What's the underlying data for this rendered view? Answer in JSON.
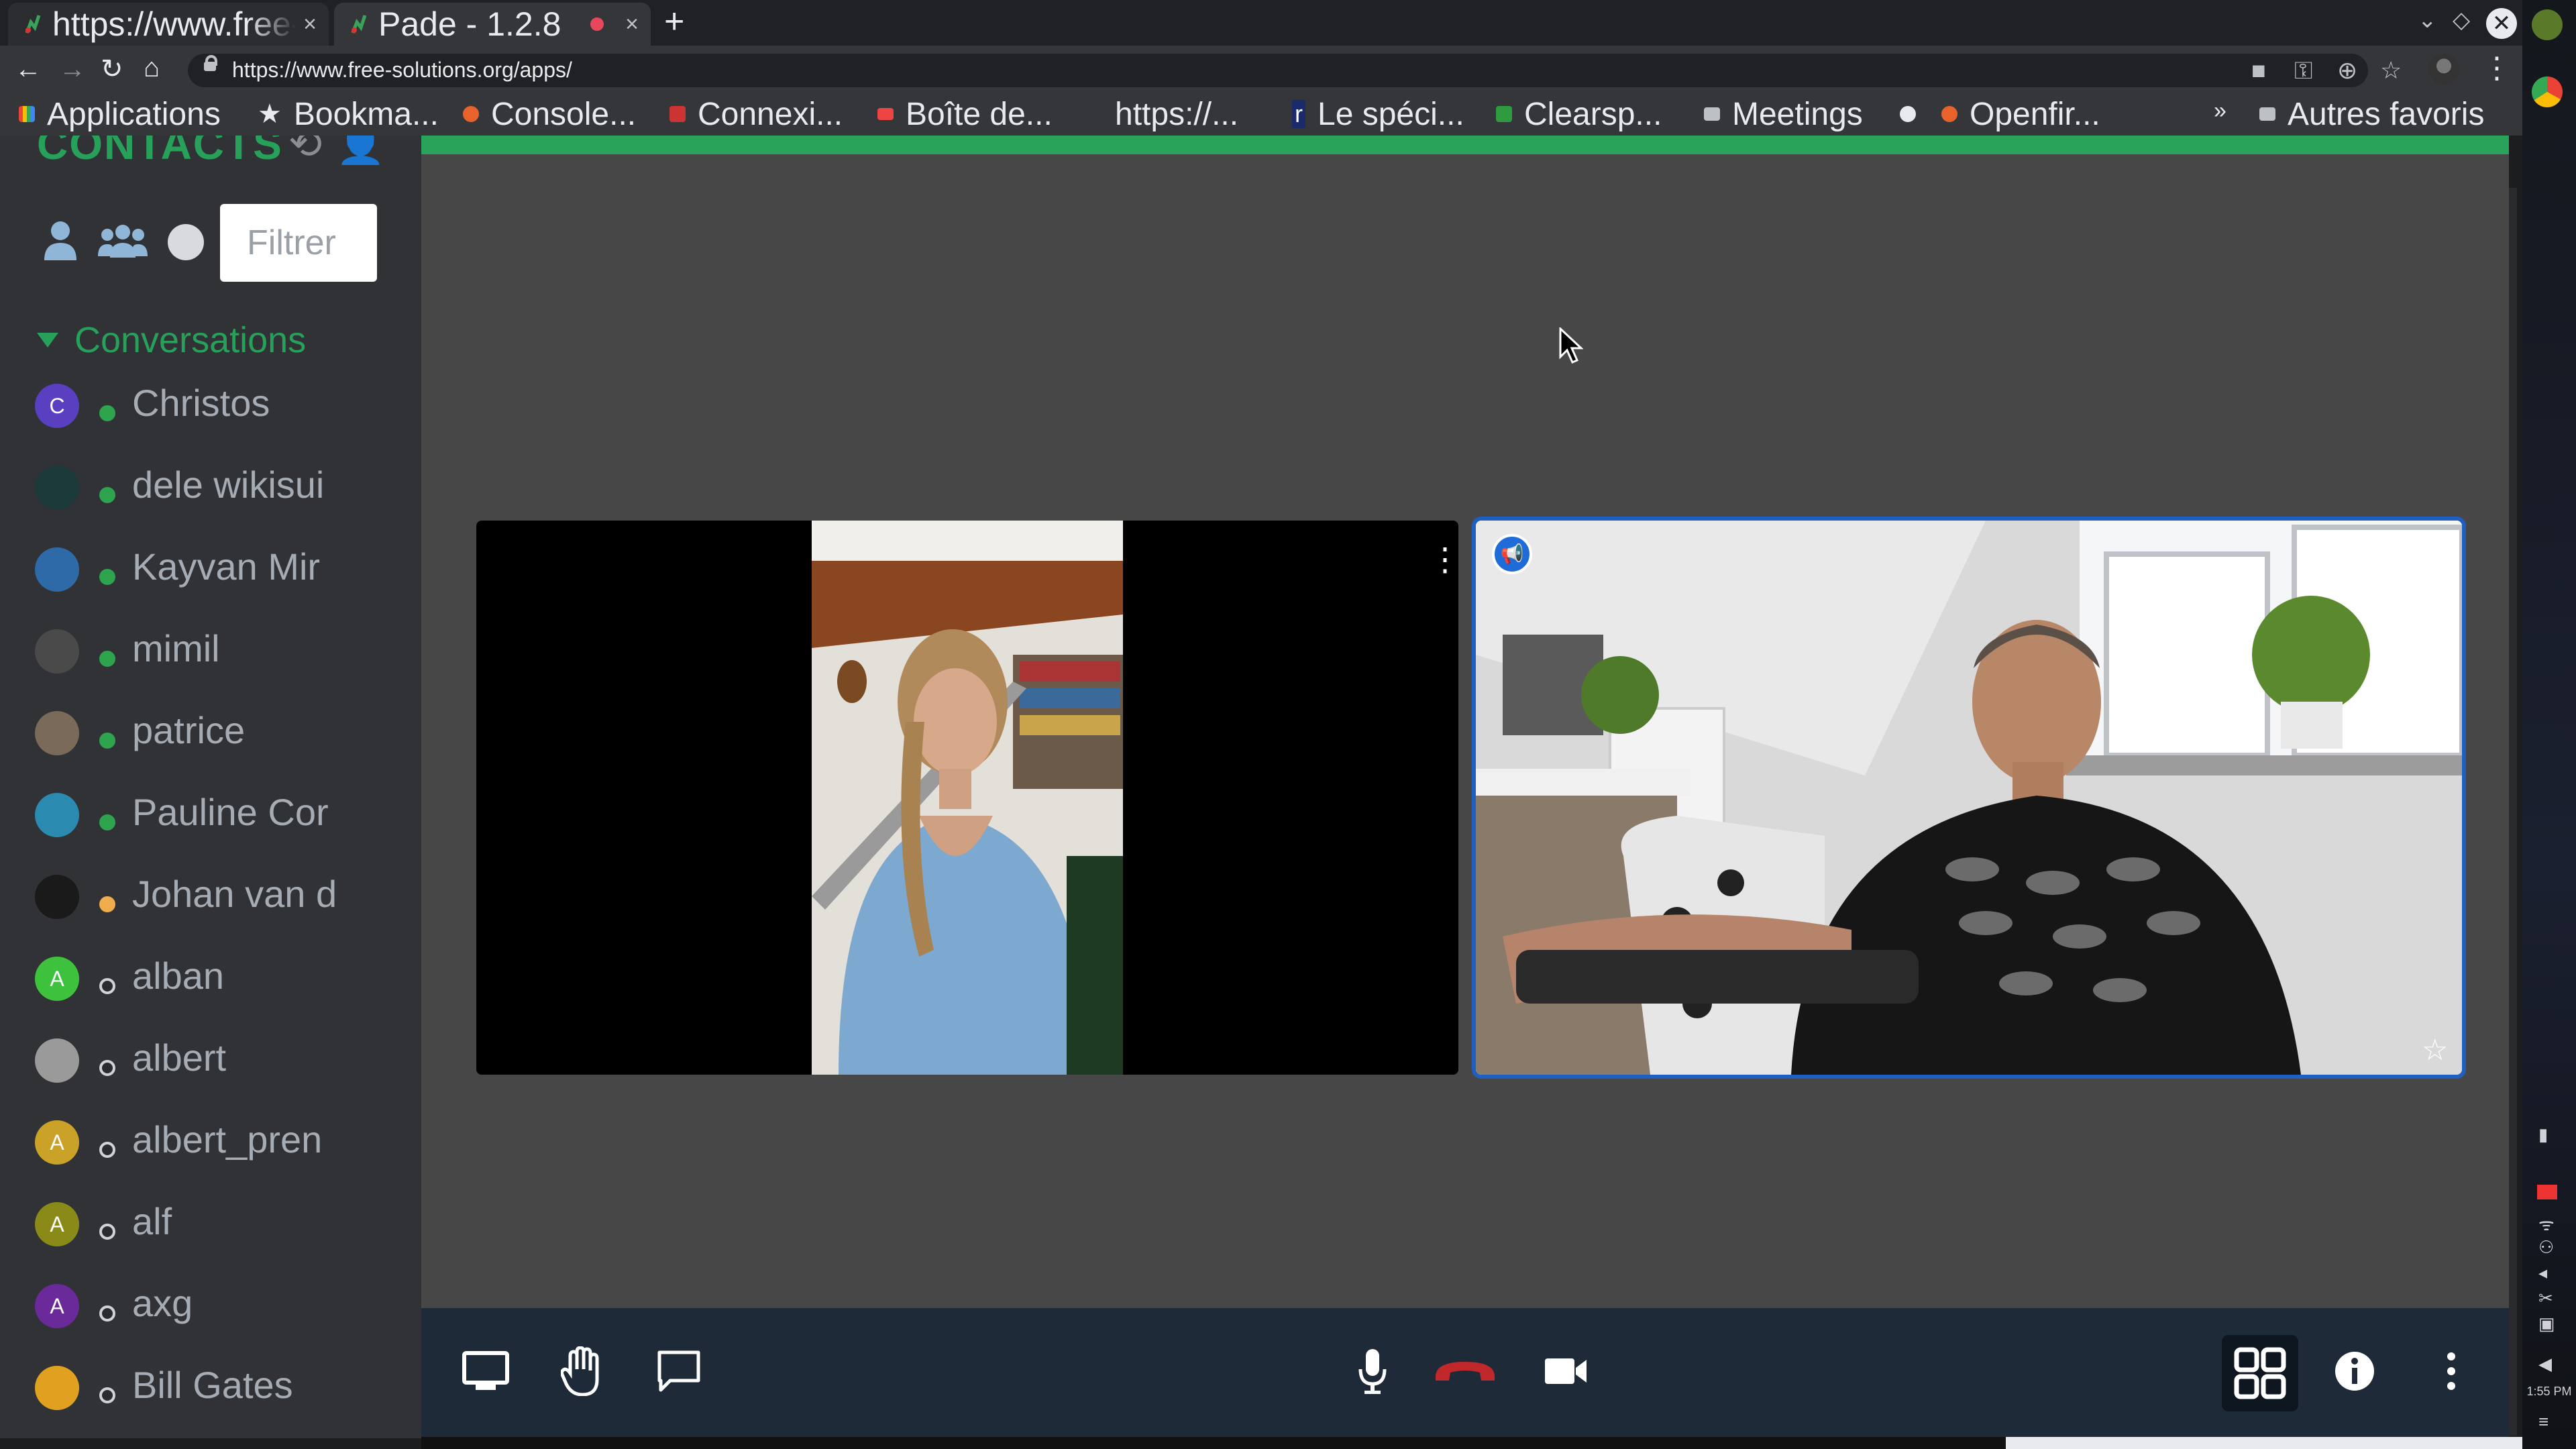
{
  "browser": {
    "tabs": [
      {
        "title": "https://www.free-solutions.org/apps/",
        "close": "×"
      },
      {
        "title": "Pade - 1.2.8",
        "close": "×"
      }
    ],
    "new_tab": "+",
    "url": "https://www.free-solutions.org/apps/",
    "bookmarks": [
      {
        "label": "Applications",
        "icon": "apps-grid-icon"
      },
      {
        "label": "Bookma...",
        "icon": "star-icon"
      },
      {
        "label": "Console...",
        "icon": "openfire-icon"
      },
      {
        "label": "Connexi...",
        "icon": "connexion-icon"
      },
      {
        "label": "Boîte de...",
        "icon": "gmail-icon"
      },
      {
        "label": "https://...",
        "icon": "page-icon"
      },
      {
        "label": "Le spéci...",
        "icon": "r-icon"
      },
      {
        "label": "Clearsp...",
        "icon": "clearspace-icon"
      },
      {
        "label": "Meetings",
        "icon": "folder-icon"
      },
      {
        "label": "",
        "icon": "globe-icon"
      },
      {
        "label": "Openfir...",
        "icon": "openfire-icon"
      },
      {
        "label": "Autres favoris",
        "icon": "folder-icon"
      }
    ],
    "bookmarks_more": "»"
  },
  "sidebar": {
    "title": "CONTACTS",
    "filter_placeholder": "Filtrer",
    "conversations_label": "Conversations",
    "contacts": [
      {
        "name": "Christos",
        "initial": "C",
        "status": "online",
        "avatar_color": "#5a3fc0"
      },
      {
        "name": "dele wikisui",
        "initial": "",
        "status": "online",
        "avatar_color": "#1c3a3a"
      },
      {
        "name": "Kayvan Mir",
        "initial": "",
        "status": "online",
        "avatar_color": "#2f6aa8"
      },
      {
        "name": "mimil",
        "initial": "",
        "status": "online",
        "avatar_color": "#4a4a4a"
      },
      {
        "name": "patrice",
        "initial": "",
        "status": "online",
        "avatar_color": "#7a6a5a"
      },
      {
        "name": "Pauline Cor",
        "initial": "",
        "status": "online",
        "avatar_color": "#2a8ab0"
      },
      {
        "name": "Johan van d",
        "initial": "",
        "status": "away",
        "avatar_color": "#1a1a1a"
      },
      {
        "name": "alban",
        "initial": "A",
        "status": "offline",
        "avatar_color": "#3ec23e"
      },
      {
        "name": "albert",
        "initial": "",
        "status": "offline",
        "avatar_color": "#9a9a9a"
      },
      {
        "name": "albert_pren",
        "initial": "A",
        "status": "offline",
        "avatar_color": "#c9a227"
      },
      {
        "name": "alf",
        "initial": "A",
        "status": "offline",
        "avatar_color": "#8a8a18"
      },
      {
        "name": "axg",
        "initial": "A",
        "status": "offline",
        "avatar_color": "#6a2a9a"
      },
      {
        "name": "Bill Gates",
        "initial": "",
        "status": "offline",
        "avatar_color": "#e0a020"
      }
    ]
  },
  "meeting": {
    "participants": [
      {
        "video": "woman-video"
      },
      {
        "video": "man-video",
        "dominant_speaker": true
      }
    ],
    "toolbar": {
      "left": [
        "screen-share-icon",
        "raise-hand-icon",
        "chat-icon"
      ],
      "center": [
        "microphone-icon",
        "hangup-icon",
        "camera-icon"
      ],
      "right": [
        "tile-view-icon",
        "info-icon",
        "more-icon"
      ]
    },
    "colors": {
      "accent_green": "#2aa35a",
      "hangup_red": "#c0282b",
      "dominant_blue": "#1e5fbf"
    }
  },
  "os": {
    "clock": "1:55 PM"
  }
}
